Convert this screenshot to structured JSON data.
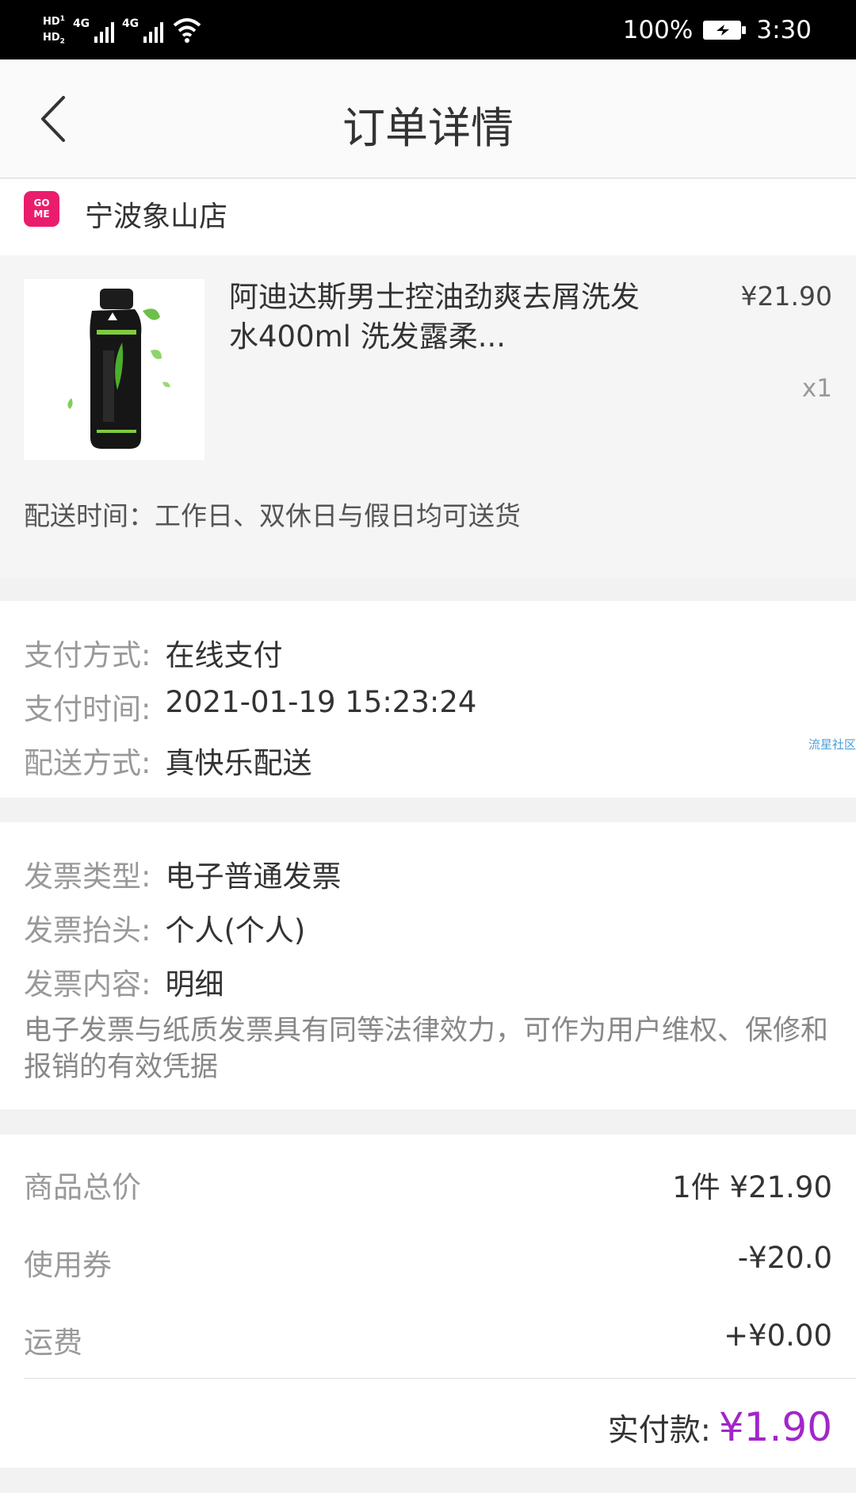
{
  "status_bar": {
    "hd1": "HD",
    "hd1_sub": "1",
    "hd2": "HD",
    "hd2_sub": "2",
    "signal1": "4G",
    "signal2": "4G",
    "battery_pct": "100%",
    "time": "3:30"
  },
  "header": {
    "title": "订单详情"
  },
  "store": {
    "logo_top": "GO",
    "logo_bottom": "ME",
    "name": "宁波象山店"
  },
  "product": {
    "name": "阿迪达斯男士控油劲爽去屑洗发水400ml 洗发露柔...",
    "price": "¥21.90",
    "qty": "x1",
    "delivery_time": "配送时间：工作日、双休日与假日均可送货",
    "image_icon": "shampoo-bottle-image"
  },
  "payment": {
    "method_label": "支付方式:",
    "method_value": "在线支付",
    "time_label": "支付时间:",
    "time_value": "2021-01-19 15:23:24",
    "shipping_label": "配送方式:",
    "shipping_value": "真快乐配送",
    "watermark": "流星社区"
  },
  "invoice": {
    "type_label": "发票类型:",
    "type_value": "电子普通发票",
    "title_label": "发票抬头:",
    "title_value": "个人(个人)",
    "content_label": "发票内容:",
    "content_value": "明细",
    "note": "电子发票与纸质发票具有同等法律效力，可作为用户维权、保修和报销的有效凭据"
  },
  "summary": {
    "total_label": "商品总价",
    "total_value": "1件 ¥21.90",
    "coupon_label": "使用券",
    "coupon_value": "-¥20.0",
    "shipping_label": "运费",
    "shipping_value": "+¥0.00",
    "paid_label": "实付款:",
    "paid_value": "¥1.90"
  },
  "colors": {
    "accent": "#a226c9",
    "store_logo": "#ea1d6c"
  }
}
